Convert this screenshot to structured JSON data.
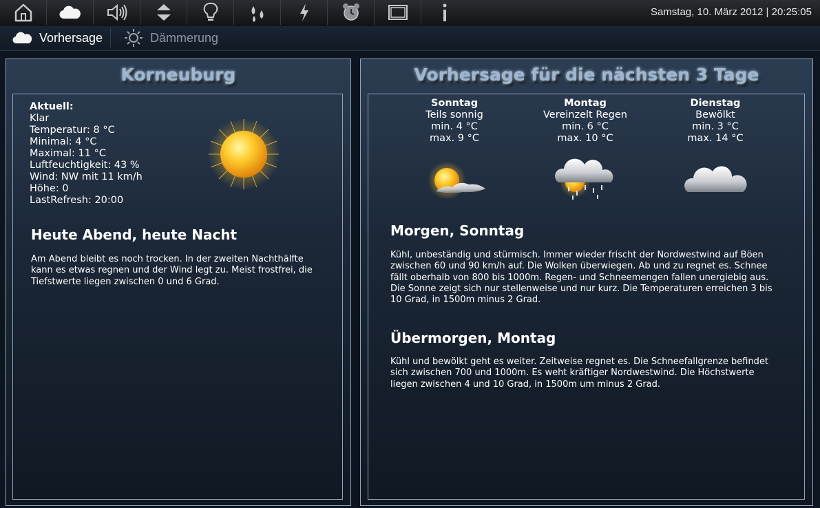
{
  "toolbar": {
    "items": [
      {
        "name": "home-icon"
      },
      {
        "name": "cloud-icon"
      },
      {
        "name": "speaker-icon"
      },
      {
        "name": "up-down-arrows-icon"
      },
      {
        "name": "lightbulb-icon"
      },
      {
        "name": "water-drops-icon"
      },
      {
        "name": "lightning-icon"
      },
      {
        "name": "alarm-clock-icon"
      },
      {
        "name": "screen-icon"
      },
      {
        "name": "info-icon"
      }
    ],
    "datetime": "Samstag, 10. März 2012 | 20:25:05"
  },
  "tabs": [
    {
      "label": "Vorhersage",
      "icon": "cloud-icon",
      "active": true
    },
    {
      "label": "Dämmerung",
      "icon": "sun-icon",
      "active": false
    }
  ],
  "left": {
    "title": "Korneuburg",
    "current": {
      "heading": "Aktuell:",
      "lines": [
        "Klar",
        "Temperatur: 8 °C",
        "Minimal: 4 °C",
        "Maximal: 11 °C",
        "Luftfeuchtigkeit: 43 %",
        "Wind: NW mit 11 km/h",
        "Höhe: 0",
        "LastRefresh: 20:00"
      ],
      "icon": "sun-icon"
    },
    "tonight": {
      "heading": "Heute Abend, heute Nacht",
      "text": "Am Abend bleibt es noch trocken. In der zweiten Nachthälfte kann es etwas regnen und der Wind legt zu. Meist frostfrei, die Tiefstwerte liegen zwischen 0 und 6 Grad."
    }
  },
  "right": {
    "title": "Vorhersage für die nächsten 3 Tage",
    "days": [
      {
        "name": "Sonntag",
        "condition": "Teils sonnig",
        "min": "min. 4 °C",
        "max": "max. 9 °C",
        "icon": "sun-cloud-icon"
      },
      {
        "name": "Montag",
        "condition": "Vereinzelt Regen",
        "min": "min. 6 °C",
        "max": "max. 10 °C",
        "icon": "cloud-rain-sun-icon"
      },
      {
        "name": "Dienstag",
        "condition": "Bewölkt",
        "min": "min. 3 °C",
        "max": "max. 14 °C",
        "icon": "cloud-icon"
      }
    ],
    "sections": [
      {
        "heading": "Morgen, Sonntag",
        "text": "Kühl, unbeständig und stürmisch. Immer wieder frischt der Nordwestwind auf Böen zwischen 60 und 90 km/h auf. Die Wolken überwiegen. Ab und zu regnet es. Schnee fällt oberhalb von 800 bis 1000m. Regen- und Schneemengen fallen unergiebig aus. Die Sonne zeigt sich nur stellenweise und nur kurz. Die Temperaturen erreichen 3 bis 10 Grad, in 1500m minus 2 Grad."
      },
      {
        "heading": "Übermorgen, Montag",
        "text": "Kühl und bewölkt geht es weiter. Zeitweise regnet es. Die Schneefallgrenze befindet sich zwischen 700 und 1000m. Es weht kräftiger Nordwestwind. Die Höchstwerte liegen zwischen 4 und 10 Grad, in 1500m um minus 2 Grad."
      }
    ]
  }
}
